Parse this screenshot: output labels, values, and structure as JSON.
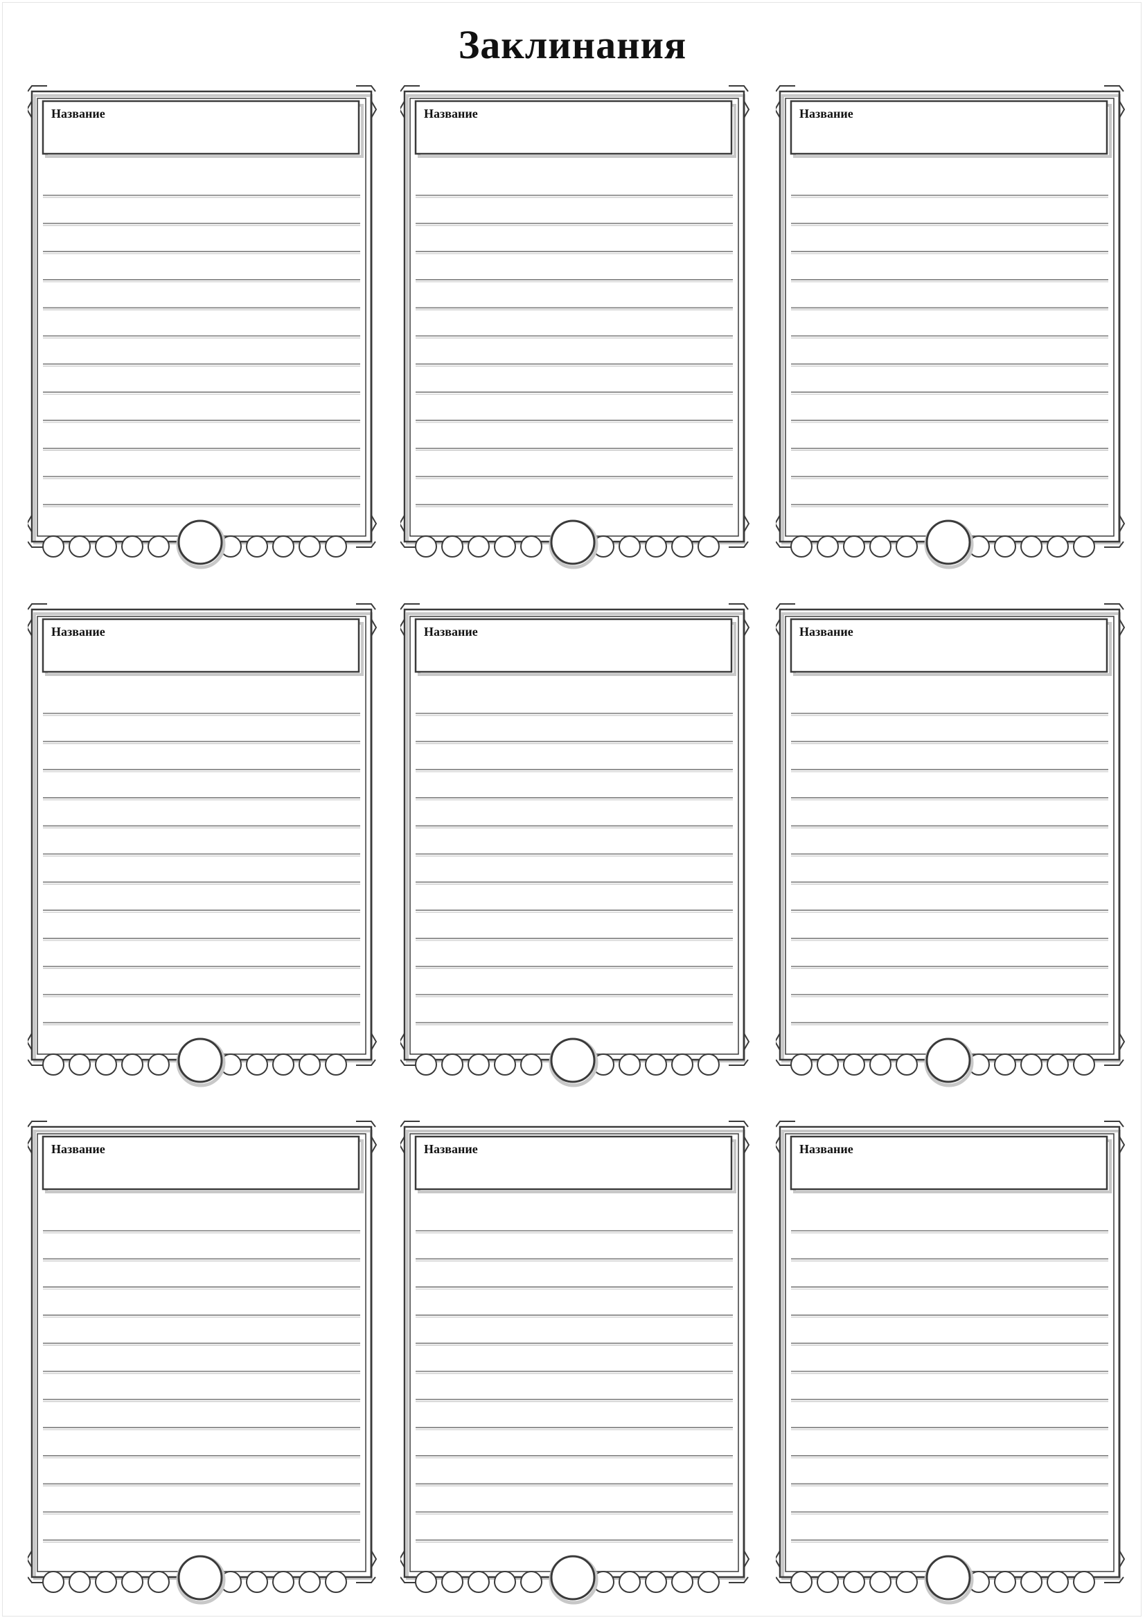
{
  "page": {
    "title": "Заклинания"
  },
  "colors": {
    "ink": "#111111",
    "frame": "#3a3a3a",
    "line": "#7a7a7a",
    "shadow": "#c8c8c8"
  },
  "icons": [
    "level-circle-icon",
    "slot-circle-icon",
    "corner-flourish-icon"
  ],
  "cards": [
    {
      "name_label": "Название",
      "slot_count": 10,
      "line_count": 12
    },
    {
      "name_label": "Название",
      "slot_count": 10,
      "line_count": 12
    },
    {
      "name_label": "Название",
      "slot_count": 10,
      "line_count": 12
    },
    {
      "name_label": "Название",
      "slot_count": 10,
      "line_count": 12
    },
    {
      "name_label": "Название",
      "slot_count": 10,
      "line_count": 12
    },
    {
      "name_label": "Название",
      "slot_count": 10,
      "line_count": 12
    },
    {
      "name_label": "Название",
      "slot_count": 10,
      "line_count": 12
    },
    {
      "name_label": "Название",
      "slot_count": 10,
      "line_count": 12
    },
    {
      "name_label": "Название",
      "slot_count": 10,
      "line_count": 12
    }
  ]
}
